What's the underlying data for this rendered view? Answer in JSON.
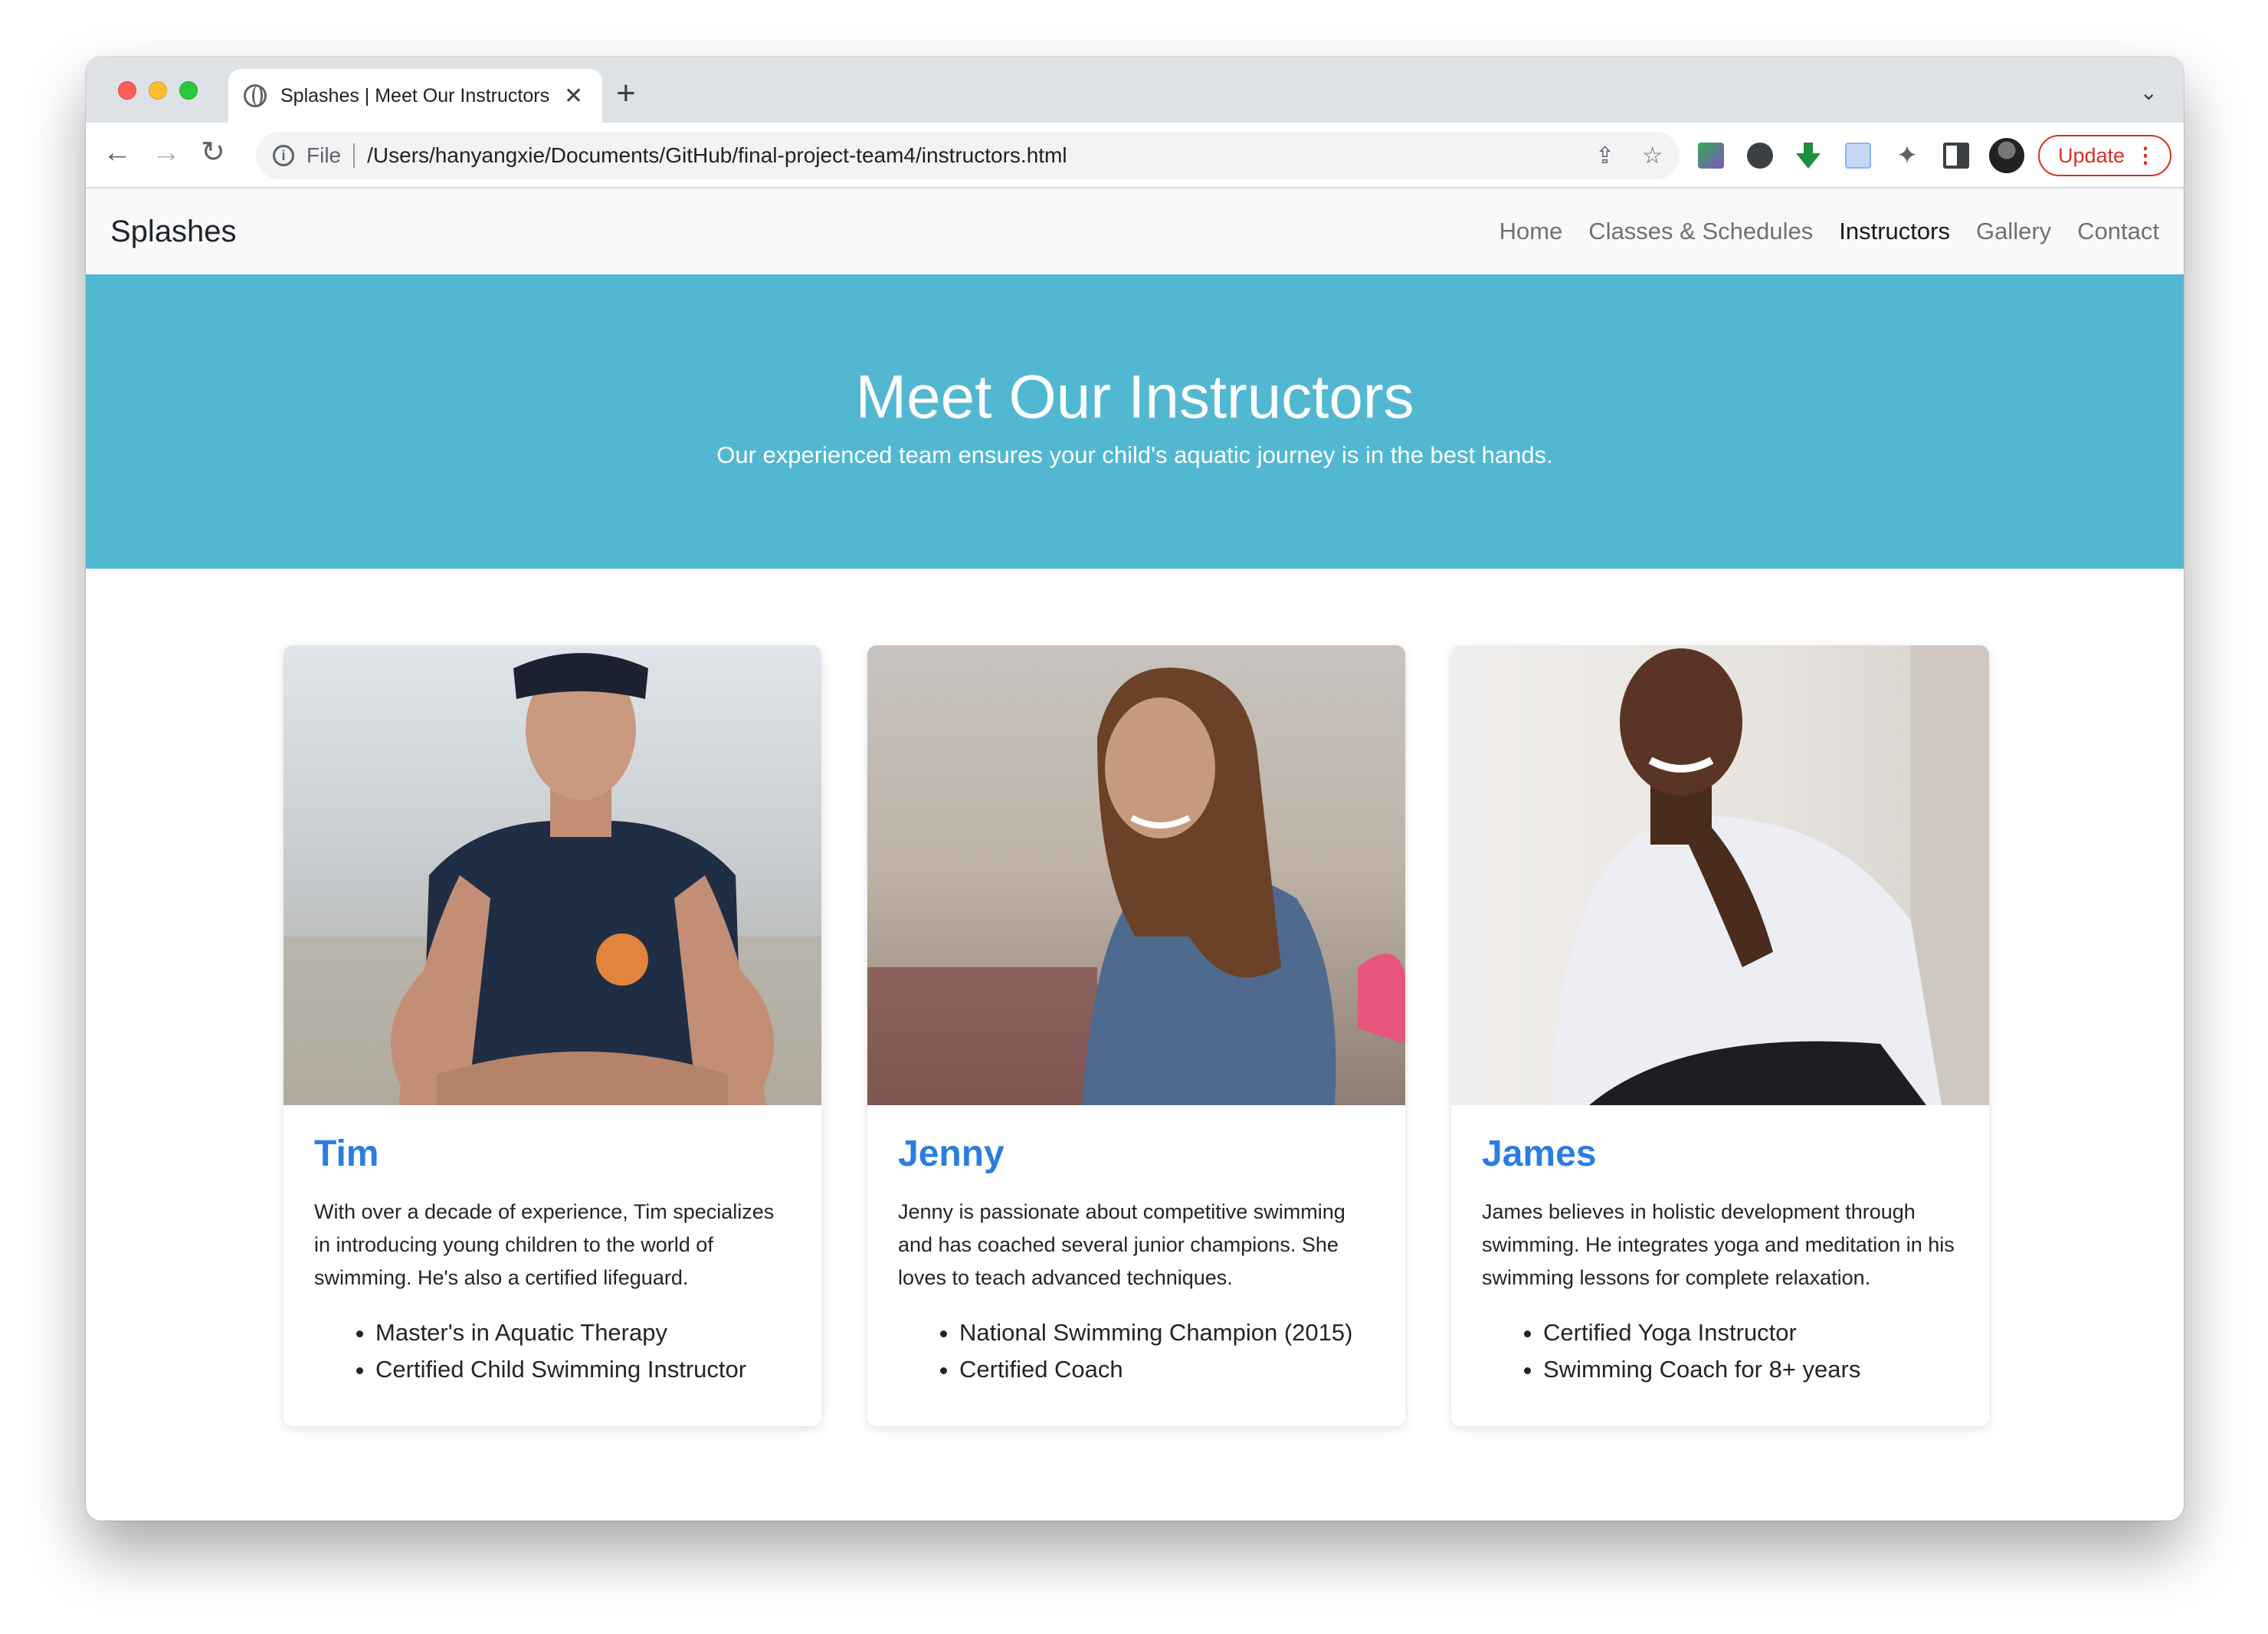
{
  "browser": {
    "tab_title": "Splashes | Meet Our Instructors",
    "url_scheme": "File",
    "url": "/Users/hanyangxie/Documents/GitHub/final-project-team4/instructors.html",
    "update_label": "Update",
    "icons": [
      "globe-icon",
      "close-icon",
      "new-tab-icon",
      "back-icon",
      "forward-icon",
      "reload-icon",
      "info-icon",
      "share-icon",
      "star-icon",
      "extensions-icon",
      "side-panel-icon",
      "profile-avatar",
      "more-icon"
    ]
  },
  "site": {
    "brand": "Splashes",
    "nav": [
      {
        "label": "Home",
        "active": false
      },
      {
        "label": "Classes & Schedules",
        "active": false
      },
      {
        "label": "Instructors",
        "active": true
      },
      {
        "label": "Gallery",
        "active": false
      },
      {
        "label": "Contact",
        "active": false
      }
    ]
  },
  "hero": {
    "title": "Meet Our Instructors",
    "subtitle": "Our experienced team ensures your child's aquatic journey is in the best hands."
  },
  "instructors": [
    {
      "name": "Tim",
      "description": "With over a decade of experience, Tim specializes in introducing young children to the world of swimming. He's also a certified lifeguard.",
      "credentials": [
        "Master's in Aquatic Therapy",
        "Certified Child Swimming Instructor"
      ]
    },
    {
      "name": "Jenny",
      "description": "Jenny is passionate about competitive swimming and has coached several junior champions. She loves to teach advanced techniques.",
      "credentials": [
        "National Swimming Champion (2015)",
        "Certified Coach"
      ]
    },
    {
      "name": "James",
      "description": "James believes in holistic development through swimming. He integrates yoga and meditation in his swimming lessons for complete relaxation.",
      "credentials": [
        "Certified Yoga Instructor",
        "Swimming Coach for 8+ years"
      ]
    }
  ],
  "colors": {
    "hero_bg": "#52b8d2",
    "name_accent": "#2a7de1",
    "nav_bg": "#f8f9fa",
    "update_red": "#d93025"
  }
}
